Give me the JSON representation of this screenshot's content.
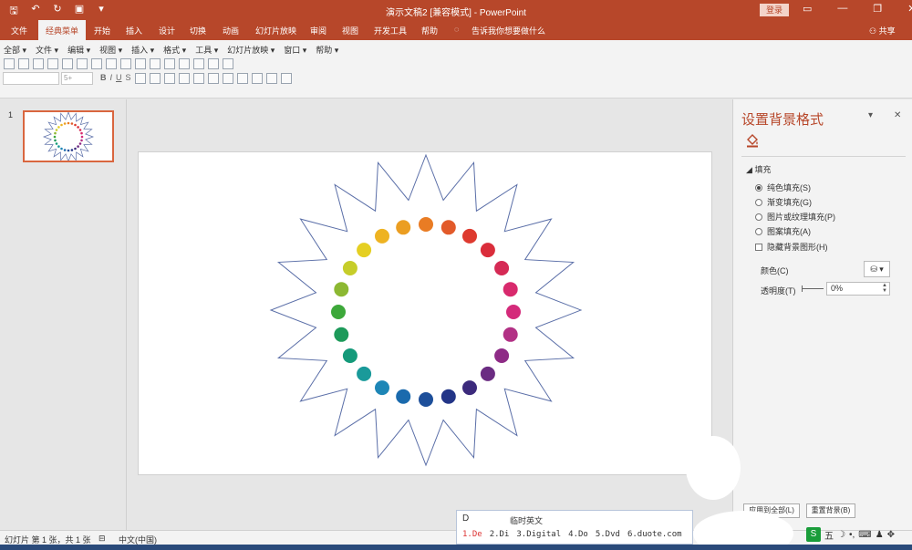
{
  "titlebar": {
    "title": "演示文稿2 [兼容模式] - PowerPoint",
    "login": "登录",
    "qat_icons": [
      "save-icon",
      "undo-icon",
      "redo-icon",
      "present-icon",
      "customize-icon"
    ]
  },
  "tabs": {
    "file": "文件",
    "classic": "经典菜单",
    "home": "开始",
    "insert": "插入",
    "design": "设计",
    "transitions": "切换",
    "animations": "动画",
    "slideshow": "幻灯片放映",
    "review": "审阅",
    "view": "视图",
    "developer": "开发工具",
    "help": "帮助",
    "tellme": "告诉我你想要做什么",
    "share": "共享"
  },
  "menu": {
    "all": "全部 ▾",
    "file": "文件 ▾",
    "edit": "编辑 ▾",
    "view": "视图 ▾",
    "insert": "插入 ▾",
    "format": "格式 ▾",
    "tools": "工具 ▾",
    "slideshow": "幻灯片放映 ▾",
    "window": "窗口 ▾",
    "help": "帮助 ▾"
  },
  "font_size_placeholder": "5+",
  "thumbnail": {
    "number": "1"
  },
  "format_pane": {
    "title": "设置背景格式",
    "fill_heading": "填充",
    "options": {
      "solid": "纯色填充(S)",
      "gradient": "渐变填充(G)",
      "picture": "图片或纹理填充(P)",
      "pattern": "图案填充(A)",
      "hide_graphics": "隐藏背景图形(H)"
    },
    "color_label": "颜色(C)",
    "transparency_label": "透明度(T)",
    "transparency_value": "0%",
    "apply_all": "应用到全部(L)",
    "reset": "重置背景(B)"
  },
  "status": {
    "slide_info": "幻灯片 第 1 张，共 1 张",
    "language": "中文(中国)"
  },
  "ime": {
    "input": "D",
    "hint": "临时英文",
    "candidates": [
      "1.De",
      "2.Di",
      "3.Digital",
      "4.Do",
      "5.Dvd",
      "6.duote.com"
    ]
  },
  "tray": {
    "ime_mode": "五"
  },
  "colors": {
    "accent": "#b7472a",
    "star_stroke": "#5b6fa8",
    "dots": [
      "#e97c24",
      "#e25a2a",
      "#de3a2f",
      "#da2d3b",
      "#d52a55",
      "#d82a6d",
      "#d42a7a",
      "#b23185",
      "#8e2b86",
      "#6b2c82",
      "#3c2a7c",
      "#233587",
      "#1d4f9a",
      "#1a6aad",
      "#1d86b6",
      "#1a9a9a",
      "#159a7a",
      "#1d9a5a",
      "#3da83a",
      "#8cb832",
      "#c6cd2a",
      "#e5cf22",
      "#eeb322",
      "#eb9e22"
    ]
  }
}
